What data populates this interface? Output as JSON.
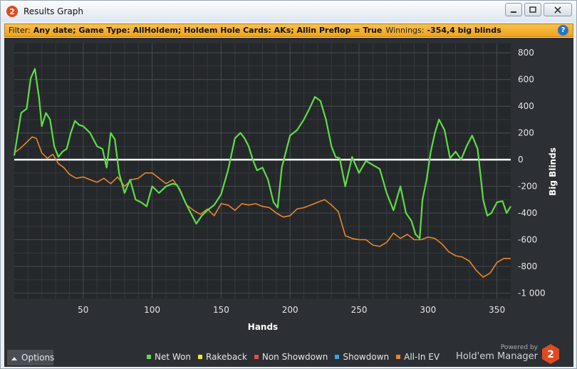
{
  "window": {
    "title": "Results Graph",
    "icon": "hem2-logo-icon",
    "controls": [
      "minimize",
      "maximize",
      "close"
    ]
  },
  "filter_bar": {
    "label": "Filter:",
    "value": "Any date; Game Type: AllHoldem; Holdem Hole Cards: AKs; Allin Preflop = True",
    "winnings_label": "Winnings:",
    "winnings_value": "-354,4 big blinds",
    "help_icon": "?"
  },
  "axes": {
    "x_label": "Hands",
    "y_label": "Big Blinds"
  },
  "legend": [
    {
      "name": "Net Won",
      "color": "#5fdc46"
    },
    {
      "name": "Rakeback",
      "color": "#f5e431"
    },
    {
      "name": "Non Showdown",
      "color": "#e84a4a"
    },
    {
      "name": "Showdown",
      "color": "#2ea8e6"
    },
    {
      "name": "All-In EV",
      "color": "#e8862b"
    }
  ],
  "options_button": {
    "label": "Options",
    "icon": "caret-up-icon"
  },
  "branding": {
    "powered_by": "Powered by",
    "name": "Hold'em Manager",
    "logo_text": "2"
  },
  "chart_data": {
    "type": "line",
    "xlabel": "Hands",
    "ylabel": "Big Blinds",
    "xlim": [
      0,
      360
    ],
    "ylim": [
      -1000,
      800
    ],
    "x_ticks": [
      50,
      100,
      150,
      200,
      250,
      300,
      350
    ],
    "y_ticks": [
      800,
      600,
      400,
      200,
      0,
      -200,
      -400,
      -600,
      -800,
      -1000
    ],
    "y_tick_labels": [
      "800",
      "600",
      "400",
      "200",
      "0",
      "-200",
      "-400",
      "-600",
      "-800",
      "-1 000"
    ],
    "zero_line": true,
    "grid": true,
    "series": [
      {
        "name": "Net Won",
        "color": "#5fdc46",
        "x": [
          0,
          5,
          9,
          12,
          15,
          18,
          20,
          23,
          26,
          29,
          32,
          35,
          38,
          41,
          44,
          47,
          50,
          55,
          60,
          64,
          67,
          70,
          73,
          76,
          80,
          84,
          88,
          92,
          96,
          100,
          105,
          110,
          115,
          118,
          121,
          124,
          128,
          132,
          136,
          140,
          145,
          150,
          155,
          160,
          164,
          167,
          170,
          173,
          176,
          180,
          184,
          188,
          191,
          194,
          197,
          200,
          205,
          210,
          214,
          218,
          222,
          226,
          230,
          233,
          236,
          240,
          245,
          250,
          255,
          260,
          265,
          270,
          275,
          280,
          284,
          288,
          291,
          294,
          296,
          299,
          302,
          305,
          308,
          312,
          316,
          320,
          324,
          328,
          332,
          336,
          340,
          343,
          346,
          350,
          354,
          357,
          360
        ],
        "y": [
          30,
          350,
          380,
          610,
          680,
          460,
          250,
          350,
          300,
          100,
          20,
          60,
          80,
          200,
          290,
          260,
          250,
          200,
          100,
          80,
          -60,
          200,
          150,
          -100,
          -250,
          -150,
          -300,
          -320,
          -350,
          -200,
          -250,
          -200,
          -180,
          -190,
          -250,
          -320,
          -400,
          -480,
          -420,
          -380,
          -340,
          -260,
          -80,
          160,
          200,
          160,
          100,
          0,
          -80,
          -60,
          -150,
          -320,
          -360,
          -60,
          60,
          180,
          220,
          300,
          380,
          470,
          440,
          300,
          100,
          20,
          10,
          -200,
          20,
          -100,
          -10,
          -40,
          -70,
          -250,
          -380,
          -200,
          -400,
          -460,
          -560,
          -590,
          -300,
          -150,
          60,
          200,
          300,
          220,
          10,
          60,
          0,
          100,
          180,
          80,
          -300,
          -420,
          -400,
          -320,
          -310,
          -400,
          -350
        ]
      },
      {
        "name": "All-In EV",
        "color": "#e8862b",
        "x": [
          0,
          5,
          10,
          13,
          16,
          20,
          24,
          28,
          32,
          36,
          40,
          45,
          50,
          55,
          60,
          65,
          70,
          75,
          80,
          85,
          90,
          95,
          100,
          105,
          110,
          115,
          120,
          125,
          130,
          135,
          140,
          145,
          150,
          155,
          160,
          165,
          170,
          175,
          180,
          185,
          190,
          195,
          200,
          205,
          210,
          215,
          220,
          225,
          230,
          235,
          240,
          245,
          250,
          255,
          260,
          265,
          270,
          275,
          280,
          285,
          290,
          295,
          300,
          305,
          310,
          315,
          320,
          325,
          330,
          335,
          340,
          345,
          350,
          355,
          360
        ],
        "y": [
          50,
          90,
          140,
          170,
          160,
          50,
          10,
          40,
          -30,
          -60,
          -110,
          -140,
          -130,
          -150,
          -170,
          -140,
          -180,
          -130,
          -200,
          -150,
          -140,
          -100,
          -100,
          -140,
          -180,
          -150,
          -220,
          -340,
          -380,
          -410,
          -370,
          -420,
          -330,
          -340,
          -380,
          -330,
          -340,
          -330,
          -350,
          -360,
          -400,
          -430,
          -420,
          -370,
          -360,
          -340,
          -320,
          -300,
          -340,
          -390,
          -570,
          -590,
          -600,
          -600,
          -640,
          -650,
          -620,
          -550,
          -590,
          -560,
          -600,
          -600,
          -580,
          -590,
          -630,
          -690,
          -720,
          -730,
          -760,
          -830,
          -880,
          -850,
          -770,
          -740,
          -740
        ]
      }
    ]
  }
}
